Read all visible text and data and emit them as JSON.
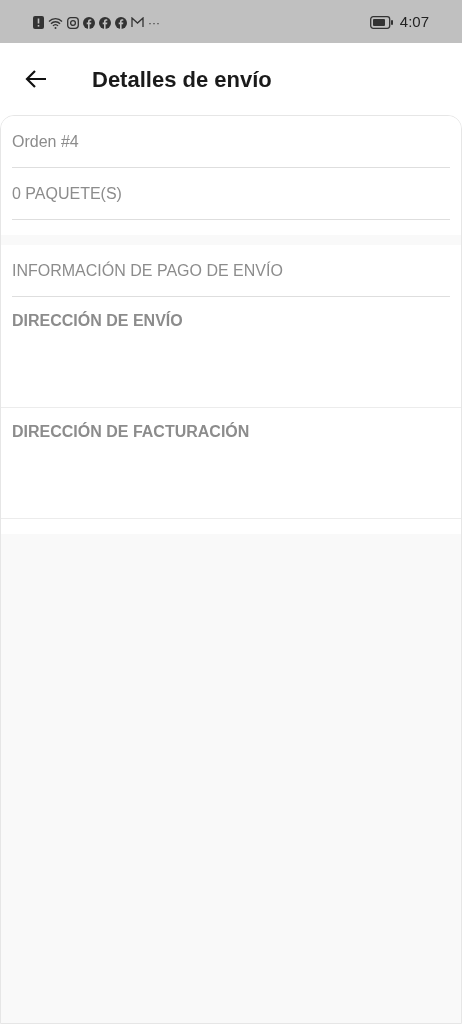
{
  "status_bar": {
    "overflow": "···",
    "time": "4:07"
  },
  "header": {
    "title": "Detalles de envío"
  },
  "summary": [
    "Orden #4",
    "0 PAQUETE(S)"
  ],
  "sections": [
    {
      "kind": "plain",
      "title": "INFORMACIÓN DE PAGO DE ENVÍO"
    },
    {
      "kind": "bold",
      "title": "DIRECCIÓN DE ENVÍO"
    },
    {
      "kind": "bold",
      "title": "DIRECCIÓN DE FACTURACIÓN"
    }
  ]
}
